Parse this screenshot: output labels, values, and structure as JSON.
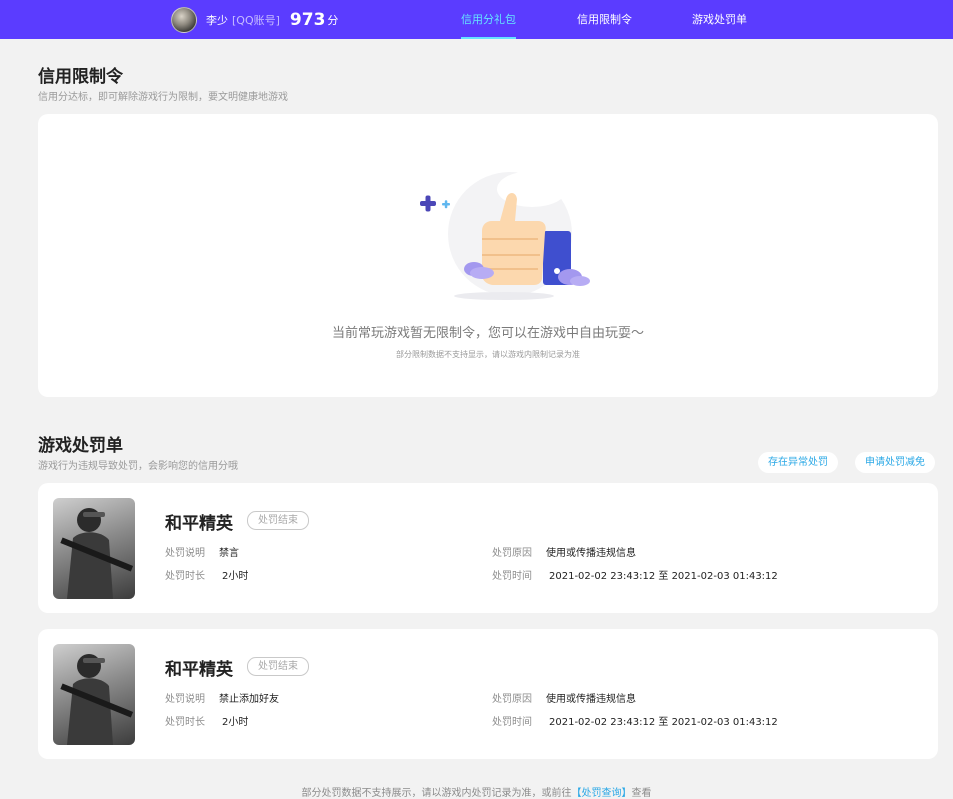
{
  "header": {
    "avatar_icon": "user-avatar",
    "username": "李少",
    "account_type": "[QQ账号]",
    "score": "973",
    "score_unit": "分",
    "tabs": [
      {
        "label": "信用分礼包",
        "active": true
      },
      {
        "label": "信用限制令",
        "active": false
      },
      {
        "label": "游戏处罚单",
        "active": false
      }
    ]
  },
  "restriction": {
    "title": "信用限制令",
    "subtitle": "信用分达标，即可解除游戏行为限制，要文明健康地游戏",
    "empty_icon": "thumbs-up-icon",
    "empty_text": "当前常玩游戏暂无限制令，您可以在游戏中自由玩耍～",
    "empty_note": "部分限制数据不支持显示，请以游戏内限制记录为准"
  },
  "penalty": {
    "title": "游戏处罚单",
    "subtitle": "游戏行为违规导致处罚，会影响您的信用分哦",
    "buttons": {
      "abnormal": "存在异常处罚",
      "appeal": "申请处罚减免"
    },
    "labels": {
      "desc": "处罚说明",
      "duration": "处罚时长",
      "reason": "处罚原因",
      "time": "处罚时间"
    },
    "cards": [
      {
        "game": "和平精英",
        "status": "处罚结束",
        "desc": "禁言",
        "duration": "2小时",
        "reason": "使用或传播违规信息",
        "time": "2021-02-02 23:43:12 至 2021-02-03 01:43:12"
      },
      {
        "game": "和平精英",
        "status": "处罚结束",
        "desc": "禁止添加好友",
        "duration": "2小时",
        "reason": "使用或传播违规信息",
        "time": "2021-02-02 23:43:12 至 2021-02-03 01:43:12"
      }
    ]
  },
  "footer": {
    "prefix": "部分处罚数据不支持展示，请以游戏内处罚记录为准，或前往",
    "link": "【处罚查询】",
    "suffix": "查看"
  },
  "colors": {
    "header_bg": "#5b3cff",
    "active_tab": "#65e3ff",
    "link": "#2aa8e6"
  }
}
